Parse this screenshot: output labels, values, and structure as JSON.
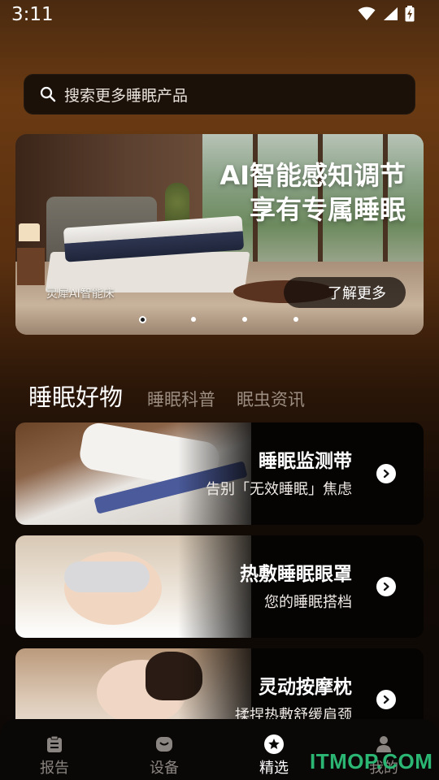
{
  "status_bar": {
    "time": "3:11"
  },
  "search": {
    "placeholder": "搜索更多睡眠产品"
  },
  "banner": {
    "title_line1": "AI智能感知调节",
    "title_line2": "享有专属睡眠",
    "caption": "灵犀AI智能床",
    "button_label": "了解更多",
    "dots_count": 4,
    "active_dot": 0
  },
  "tabs": [
    {
      "label": "睡眠好物",
      "active": true
    },
    {
      "label": "睡眠科普",
      "active": false
    },
    {
      "label": "眠虫资讯",
      "active": false
    }
  ],
  "cards": [
    {
      "title": "睡眠监测带",
      "subtitle": "告别「无效睡眠」焦虑"
    },
    {
      "title": "热敷睡眠眼罩",
      "subtitle": "您的睡眠搭档"
    },
    {
      "title": "灵动按摩枕",
      "subtitle": "揉捏热敷舒缓肩颈"
    }
  ],
  "bottom_nav": [
    {
      "label": "报告",
      "icon": "clipboard-icon",
      "active": false
    },
    {
      "label": "设备",
      "icon": "device-icon",
      "active": false
    },
    {
      "label": "精选",
      "icon": "star-badge-icon",
      "active": true
    },
    {
      "label": "我的",
      "icon": "person-icon",
      "active": false
    }
  ],
  "watermark": "ITMOP.COM"
}
